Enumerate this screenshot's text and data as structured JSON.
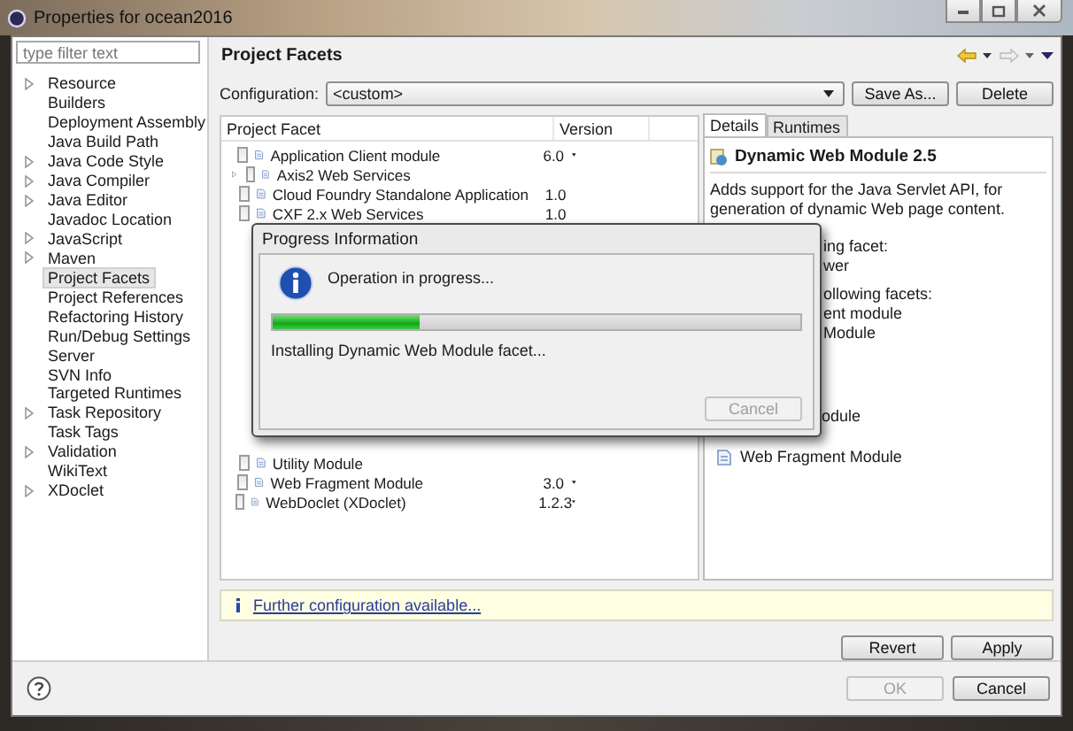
{
  "window": {
    "title": "Properties for ocean2016"
  },
  "filter": {
    "placeholder": "type filter text"
  },
  "tree": [
    {
      "label": "Resource",
      "expandable": true,
      "selected": false
    },
    {
      "label": "Builders",
      "expandable": false,
      "selected": false
    },
    {
      "label": "Deployment Assembly",
      "expandable": false,
      "selected": false
    },
    {
      "label": "Java Build Path",
      "expandable": false,
      "selected": false
    },
    {
      "label": "Java Code Style",
      "expandable": true,
      "selected": false
    },
    {
      "label": "Java Compiler",
      "expandable": true,
      "selected": false
    },
    {
      "label": "Java Editor",
      "expandable": true,
      "selected": false
    },
    {
      "label": "Javadoc Location",
      "expandable": false,
      "selected": false
    },
    {
      "label": "JavaScript",
      "expandable": true,
      "selected": false
    },
    {
      "label": "Maven",
      "expandable": true,
      "selected": false
    },
    {
      "label": "Project Facets",
      "expandable": false,
      "selected": true
    },
    {
      "label": "Project References",
      "expandable": false,
      "selected": false
    },
    {
      "label": "Refactoring History",
      "expandable": false,
      "selected": false
    },
    {
      "label": "Run/Debug Settings",
      "expandable": false,
      "selected": false
    },
    {
      "label": "Server",
      "expandable": false,
      "selected": false
    },
    {
      "label": "SVN Info",
      "expandable": false,
      "selected": false
    },
    {
      "label": "Targeted Runtimes",
      "expandable": false,
      "selected": false
    },
    {
      "label": "Task Repository",
      "expandable": true,
      "selected": false
    },
    {
      "label": "Task Tags",
      "expandable": false,
      "selected": false
    },
    {
      "label": "Validation",
      "expandable": true,
      "selected": false
    },
    {
      "label": "WikiText",
      "expandable": false,
      "selected": false
    },
    {
      "label": "XDoclet",
      "expandable": true,
      "selected": false
    }
  ],
  "page": {
    "title": "Project Facets",
    "configuration_label": "Configuration:",
    "configuration_value": "<custom>",
    "buttons": [
      "Save As...",
      "Delete"
    ]
  },
  "facets": {
    "columns": [
      "Project Facet",
      "Version"
    ],
    "rows_above_dialog": [
      {
        "name": "Application Client module",
        "version": "6.0",
        "has_dropdown": true,
        "expandable": false,
        "checked": false
      },
      {
        "name": "Axis2 Web Services",
        "has_dropdown": false,
        "expandable": true,
        "checked": false
      },
      {
        "name": "Cloud Foundry Standalone Application",
        "version": "1.0",
        "has_dropdown": false,
        "expandable": false,
        "checked": false
      },
      {
        "name": "CXF 2.x Web Services",
        "version": "1.0",
        "has_dropdown": false,
        "expandable": false,
        "checked": false
      }
    ],
    "rows_below_dialog": [
      {
        "name": "Utility Module",
        "has_dropdown": false,
        "expandable": false,
        "checked": false
      },
      {
        "name": "Web Fragment Module",
        "version": "3.0",
        "has_dropdown": true,
        "expandable": false,
        "checked": false
      },
      {
        "name": "WebDoclet (XDoclet)",
        "version": "1.2.3",
        "has_dropdown": true,
        "expandable": false,
        "checked": false
      }
    ]
  },
  "details": {
    "tabs": [
      {
        "label": "Details",
        "selected": true
      },
      {
        "label": "Runtimes",
        "selected": false
      }
    ],
    "title": "Dynamic Web Module 2.5",
    "description": "Adds support for the Java Servlet API, for generation of dynamic Web page content.",
    "lines_right_of_dialog": [
      {
        "text": "ing facet:",
        "kind": "heading"
      },
      {
        "text": "wer",
        "kind": "item"
      },
      {
        "text": "ollowing facets:",
        "kind": "heading"
      },
      {
        "text": "ent module",
        "kind": "item"
      },
      {
        "text": "Module",
        "kind": "item"
      }
    ],
    "lines_below_dialog": [
      {
        "text": "odule",
        "kind": "tail"
      },
      {
        "text": "Web Fragment Module",
        "kind": "facet"
      }
    ]
  },
  "info_bar": {
    "link": "Further configuration available..."
  },
  "page_buttons": [
    {
      "label": "Revert",
      "disabled": false
    },
    {
      "label": "Apply",
      "disabled": false
    }
  ],
  "dialog_buttons": [
    {
      "label": "OK",
      "disabled": true
    },
    {
      "label": "Cancel",
      "disabled": false
    }
  ],
  "progress": {
    "title": "Progress Information",
    "message": "Operation in progress...",
    "level": 0.28,
    "task": "Installing Dynamic Web Module facet...",
    "cancel": {
      "label": "Cancel",
      "disabled": true
    }
  }
}
